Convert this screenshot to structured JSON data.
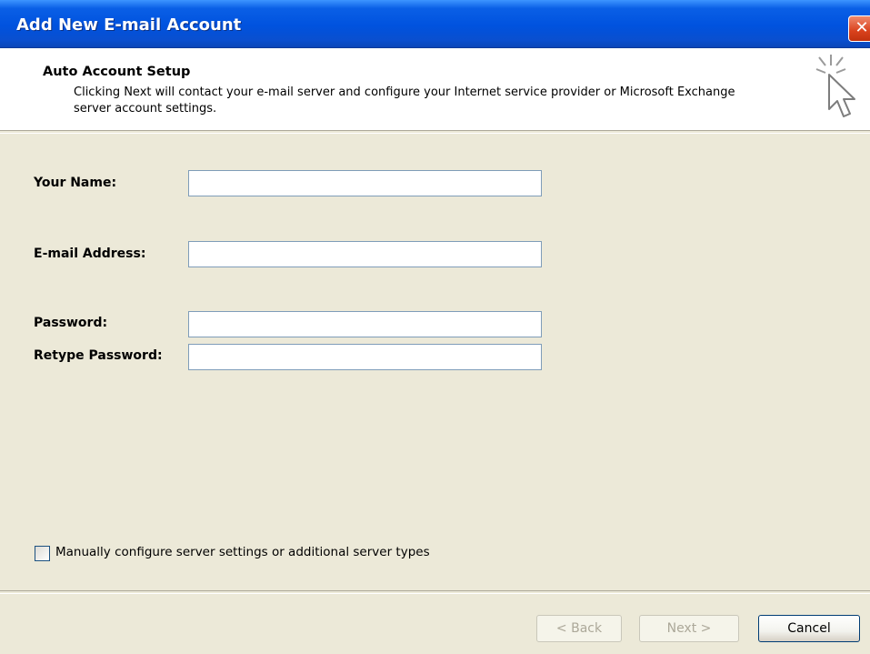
{
  "window": {
    "title": "Add New E-mail Account",
    "close_glyph": "✕"
  },
  "header": {
    "title": "Auto Account Setup",
    "description": "Clicking Next will contact your e-mail server and configure your Internet service provider or Microsoft Exchange server account settings.",
    "icon": "cursor-sparkle-icon"
  },
  "form": {
    "your_name": {
      "label": "Your Name:",
      "value": ""
    },
    "email": {
      "label": "E-mail Address:",
      "value": ""
    },
    "password": {
      "label": "Password:",
      "value": ""
    },
    "retype_password": {
      "label": "Retype Password:",
      "value": ""
    }
  },
  "manual_config": {
    "label": "Manually configure server settings or additional server types",
    "checked": false
  },
  "buttons": {
    "back": "< Back",
    "next": "Next >",
    "cancel": "Cancel"
  },
  "colors": {
    "titlebar": "#0054e3",
    "dialog_bg": "#ece9d8",
    "close": "#d9421d"
  }
}
